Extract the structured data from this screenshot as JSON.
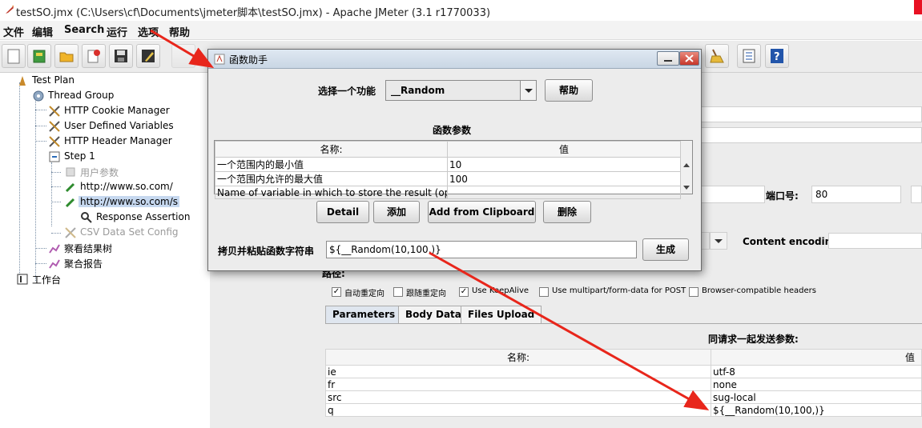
{
  "window": {
    "title": "testSO.jmx (C:\\Users\\cf\\Documents\\jmeter脚本\\testSO.jmx) - Apache JMeter (3.1 r1770033)"
  },
  "menu": [
    "文件",
    "编辑",
    "Search",
    "运行",
    "选项",
    "帮助"
  ],
  "tree": {
    "test_plan": "Test Plan",
    "thread_group": "Thread Group",
    "cookie_manager": "HTTP Cookie Manager",
    "user_vars": "User Defined Variables",
    "header_manager": "HTTP Header Manager",
    "step1": "Step 1",
    "user_params": "用户参数",
    "sampler1": "http://www.so.com/",
    "sampler2": "http://www.so.com/s",
    "assertion": "Response Assertion",
    "csv": "CSV Data Set Config",
    "results_tree": "察看结果树",
    "aggregate": "聚合报告",
    "workbench": "工作台"
  },
  "dialog": {
    "title": "函数助手",
    "select_label": "选择一个功能",
    "selected_function": "__Random",
    "help_button": "帮助",
    "params_heading": "函数参数",
    "col_name": "名称:",
    "col_value": "值",
    "rows": [
      {
        "name": "一个范围内的最小值",
        "value": "10"
      },
      {
        "name": "一个范围内允许的最大值",
        "value": "100"
      },
      {
        "name": "Name of variable in which to store the result (optio...",
        "value": ""
      }
    ],
    "buttons": {
      "detail": "Detail",
      "add": "添加",
      "add_clipboard": "Add from Clipboard",
      "delete": "删除"
    },
    "result_label": "拷贝并粘贴函数字符串",
    "result_value": "${__Random(10,100,)}",
    "generate_button": "生成"
  },
  "sampler": {
    "port_label": "端口号:",
    "port_value": "80",
    "content_encoding_label": "Content encoding:",
    "path_label": "路径:",
    "checkboxes": [
      {
        "label": "自动重定向",
        "checked": true
      },
      {
        "label": "跟随重定向",
        "checked": false
      },
      {
        "label": "Use KeepAlive",
        "checked": true
      },
      {
        "label": "Use multipart/form-data for POST",
        "checked": false
      },
      {
        "label": "Browser-compatible headers",
        "checked": false
      }
    ],
    "tabs": [
      "Parameters",
      "Body Data",
      "Files Upload"
    ],
    "params_heading": "同请求一起发送参数:",
    "col_name": "名称:",
    "col_value": "值",
    "params": [
      {
        "name": "ie",
        "value": "utf-8"
      },
      {
        "name": "fr",
        "value": "none"
      },
      {
        "name": "src",
        "value": "sug-local"
      },
      {
        "name": "q",
        "value": "${__Random(10,100,)}"
      }
    ]
  },
  "annotation_color": "#e8261b"
}
